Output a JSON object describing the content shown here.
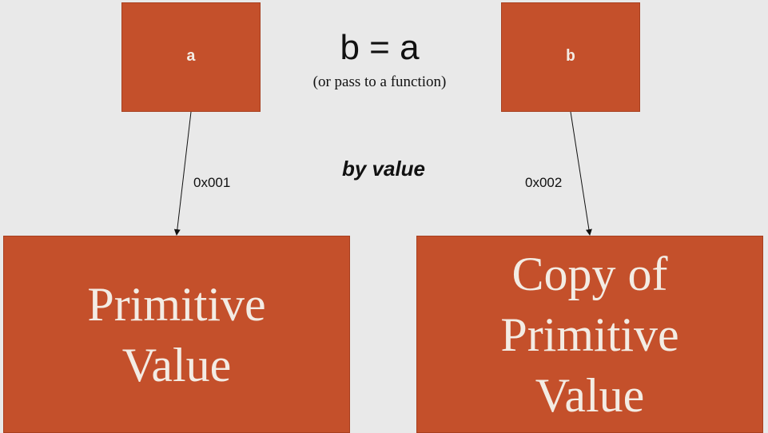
{
  "variables": {
    "a": "a",
    "b": "b"
  },
  "assignment": {
    "statement": "b = a",
    "note": "(or pass to a function)"
  },
  "mode": "by value",
  "addresses": {
    "first": "0x001",
    "second": "0x002"
  },
  "values": {
    "original": "Primitive\nValue",
    "copy": "Copy of\nPrimitive\nValue"
  },
  "colors": {
    "box": "#c4502b",
    "background": "#e9e9e9",
    "text_on_box": "#f3ece4"
  }
}
